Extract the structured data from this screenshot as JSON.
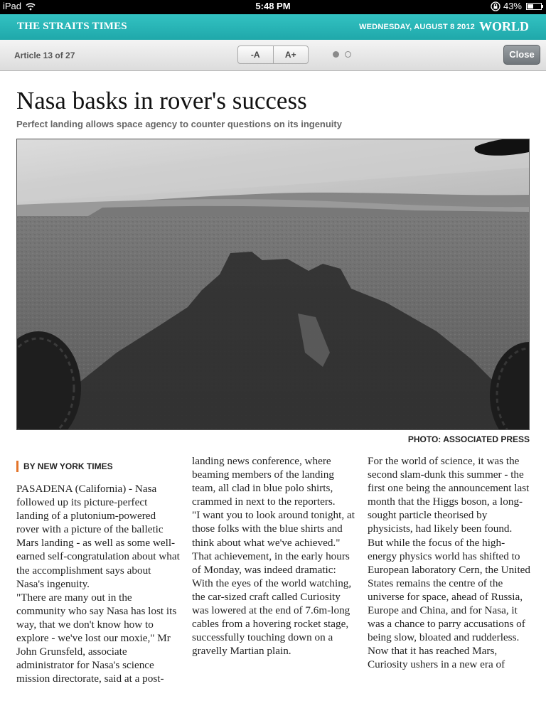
{
  "status_bar": {
    "device": "iPad",
    "time": "5:48 PM",
    "battery": "43%",
    "battery_level": 0.43
  },
  "header": {
    "masthead": "THE STRAITS TIMES",
    "date": "WEDNESDAY, AUGUST 8 2012",
    "section": "WORLD"
  },
  "toolbar": {
    "counter": "Article 13 of 27",
    "font_smaller": "-A",
    "font_larger": "A+",
    "page_dots": 2,
    "active_page": 1,
    "close_label": "Close"
  },
  "article": {
    "headline": "Nasa basks in rover's success",
    "subhead": "Perfect landing allows space agency to counter questions on its ingenuity",
    "photo_credit": "PHOTO: ASSOCIATED PRESS",
    "byline": "BY NEW YORK TIMES",
    "col1": "PASADENA (California) - Nasa followed up its picture-perfect landing of a plutonium-powered rover with a picture of the balletic Mars landing - as well as some well-earned self-congratulation about what the accomplishment says about Nasa's ingenuity.\n\"There are many out in the community who say Nasa has lost its way, that we don't know how to explore - we've lost our moxie,\" Mr John Grunsfeld, associate administrator for Nasa's science mission directorate, said at a post-",
    "col2": "landing news conference, where beaming members of the landing team, all clad in blue polo shirts, crammed in next to the reporters.\n\"I want you to look around tonight, at those folks with the blue shirts and think about what we've achieved.\"\n That achievement, in the early hours of Monday, was indeed dramatic: With the eyes of the world watching, the car-sized craft called Curiosity was lowered at the end of 7.6m-long cables from a hovering rocket stage, successfully touching down on a gravelly Martian plain.",
    "col3": " For the world of science, it was the second slam-dunk this summer - the first one being the announcement last month that the Higgs boson, a long-sought particle theorised by physicists, had likely been found.\n But while the focus of the high-energy physics world has shifted to European laboratory Cern, the United States remains the centre of the universe for space, ahead of Russia, Europe and China, and for Nasa, it was a chance to parry accusations of being slow, bloated and rudderless.\n Now that it has reached Mars, Curiosity ushers in a new era of"
  },
  "colors": {
    "header_teal": "#26b3b5",
    "byline_accent": "#e3742a"
  }
}
